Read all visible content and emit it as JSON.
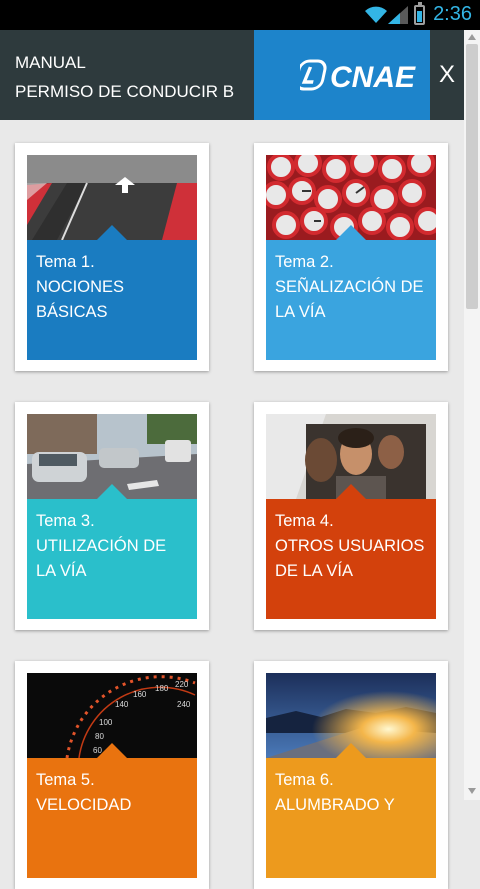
{
  "status_bar": {
    "time": "2:36",
    "icons": [
      "wifi-icon",
      "signal-icon",
      "battery-icon"
    ]
  },
  "header": {
    "title_line1": "MANUAL",
    "title_line2": "PERMISO DE CONDUCIR B",
    "logo_text": "CNAE",
    "close_label": "X"
  },
  "colors": {
    "header_bg": "#2e3a3d",
    "logo_bg": "#1d84cb",
    "page_bg": "#e9e9e9"
  },
  "topics": [
    {
      "number": "Tema 1.",
      "line1": "NOCIONES",
      "line2": "BÁSICAS",
      "color": "#1a7cc1",
      "image": "road-lane-image"
    },
    {
      "number": "Tema 2.",
      "line1": "SEÑALIZACIÓN DE",
      "line2": "LA VÍA",
      "color": "#3aa4df",
      "image": "traffic-signs-image"
    },
    {
      "number": "Tema 3.",
      "line1": "UTILIZACIÓN DE",
      "line2": "LA VÍA",
      "color": "#2abfcb",
      "image": "street-cars-image"
    },
    {
      "number": "Tema 4.",
      "line1": "OTROS USUARIOS",
      "line2": "DE LA VÍA",
      "color": "#d3410c",
      "image": "people-in-car-image"
    },
    {
      "number": "Tema 5.",
      "line1": "VELOCIDAD",
      "line2": "",
      "color": "#e9730f",
      "image": "speedometer-image"
    },
    {
      "number": "Tema 6.",
      "line1": "ALUMBRADO Y",
      "line2": "",
      "color": "#ed9a1d",
      "image": "road-light-image"
    }
  ]
}
